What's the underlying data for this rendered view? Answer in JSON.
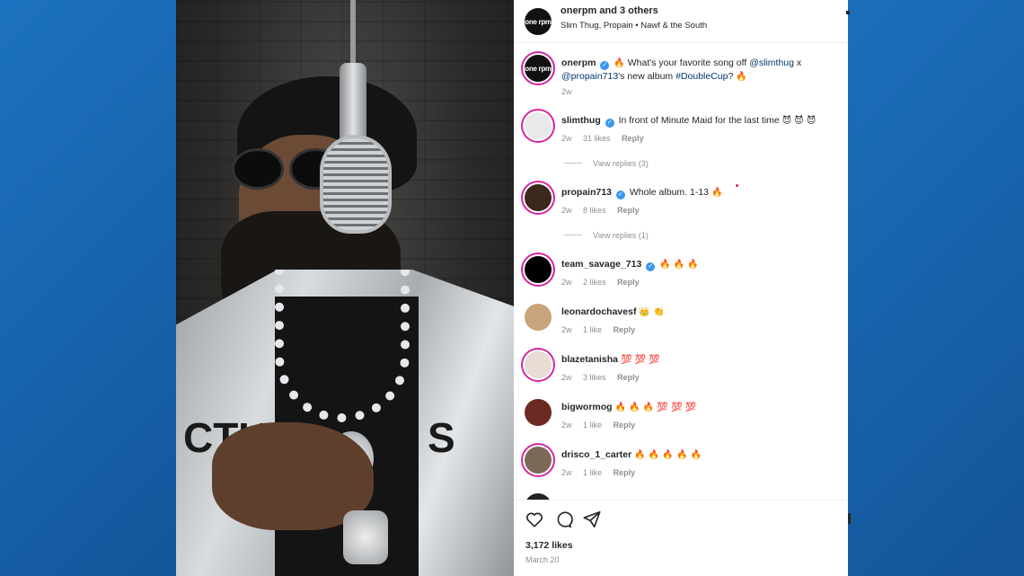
{
  "post": {
    "header": {
      "title": "onerpm and 3 others",
      "subtitle": "Slim Thug, Propain • Nawf & the South",
      "avatar_text": "one rpm"
    },
    "caption": {
      "user": "onerpm",
      "avatar_text": "one rpm",
      "text_fire": "🔥",
      "text_a": " What's your favorite song off ",
      "mention1": "@slimthug",
      "text_b": " x ",
      "mention2": "@propain713",
      "text_c": "'s new album ",
      "hashtag": "#DoubleCup",
      "text_d": "? ",
      "text_end_emoji": "🔥",
      "time": "2w"
    },
    "comments": [
      {
        "user": "slimthug",
        "verified": true,
        "text": "In front of Minute Maid for the last time",
        "emoji": "😈 😈 😈",
        "time": "2w",
        "likes": "31 likes",
        "reply": "Reply",
        "view_replies": "View replies (3)"
      },
      {
        "user": "propain713",
        "verified": true,
        "text": "Whole album. 1-13",
        "emoji": "🔥",
        "time": "2w",
        "likes": "8 likes",
        "reply": "Reply",
        "view_replies": "View replies (1)"
      },
      {
        "user": "team_savage_713",
        "verified": true,
        "text": "",
        "emoji": "🔥 🔥 🔥",
        "time": "2w",
        "likes": "2 likes",
        "reply": "Reply"
      },
      {
        "user": "leonardochavesf",
        "verified": false,
        "text": "",
        "emoji": "👑 👏",
        "time": "2w",
        "likes": "1 like",
        "reply": "Reply"
      },
      {
        "user": "blazetanisha",
        "verified": false,
        "text": "",
        "emoji": "💯 💯 💯",
        "time": "2w",
        "likes": "3 likes",
        "reply": "Reply"
      },
      {
        "user": "bigwormog",
        "verified": false,
        "text": "",
        "emoji": "🔥 🔥 🔥 💯 💯 💯",
        "time": "2w",
        "likes": "1 like",
        "reply": "Reply"
      },
      {
        "user": "drisco_1_carter",
        "verified": false,
        "text": "",
        "emoji": "🔥 🔥 🔥 🔥 🔥",
        "time": "2w",
        "likes": "1 like",
        "reply": "Reply"
      }
    ],
    "footer": {
      "likes": "3,172 likes",
      "date": "March 20",
      "icons": [
        "heart-icon",
        "comment-icon",
        "share-icon"
      ]
    },
    "photo": {
      "jacket_letters_left": "CTU",
      "jacket_letters_right": "S"
    }
  },
  "colors": {
    "background_blue": "#1763a8",
    "verified_blue": "#3897f0",
    "link_blue": "#00376b",
    "story_ring": "#d6249f"
  }
}
